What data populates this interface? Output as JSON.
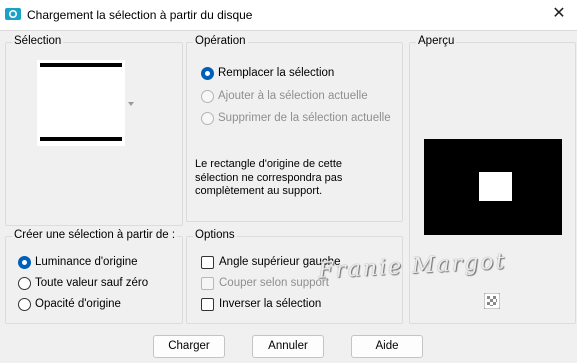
{
  "window": {
    "title": "Chargement la sélection à partir du disque",
    "close_glyph": "✕",
    "icon": "psp-selection-icon"
  },
  "selection_group": {
    "label": "Sélection"
  },
  "operation_group": {
    "label": "Opération",
    "options": [
      {
        "label": "Remplacer la sélection",
        "checked": true,
        "disabled": false
      },
      {
        "label": "Ajouter à la sélection actuelle",
        "checked": false,
        "disabled": true
      },
      {
        "label": "Supprimer de la sélection actuelle",
        "checked": false,
        "disabled": true
      }
    ],
    "message": "Le rectangle d'origine de cette sélection ne correspondra pas complètement au support."
  },
  "preview_group": {
    "label": "Aperçu",
    "watermark": "Franie Margot"
  },
  "create_group": {
    "label": "Créer une sélection à partir de :",
    "options": [
      {
        "label": "Luminance d'origine",
        "checked": true
      },
      {
        "label": "Toute valeur sauf zéro",
        "checked": false
      },
      {
        "label": "Opacité d'origine",
        "checked": false
      }
    ]
  },
  "options_group": {
    "label": "Options",
    "items": [
      {
        "label": "Angle supérieur gauche",
        "checked": false,
        "disabled": false
      },
      {
        "label": "Couper selon support",
        "checked": false,
        "disabled": true
      },
      {
        "label": "Inverser la sélection",
        "checked": false,
        "disabled": false
      }
    ]
  },
  "buttons": {
    "ok": "Charger",
    "cancel": "Annuler",
    "help": "Aide"
  }
}
